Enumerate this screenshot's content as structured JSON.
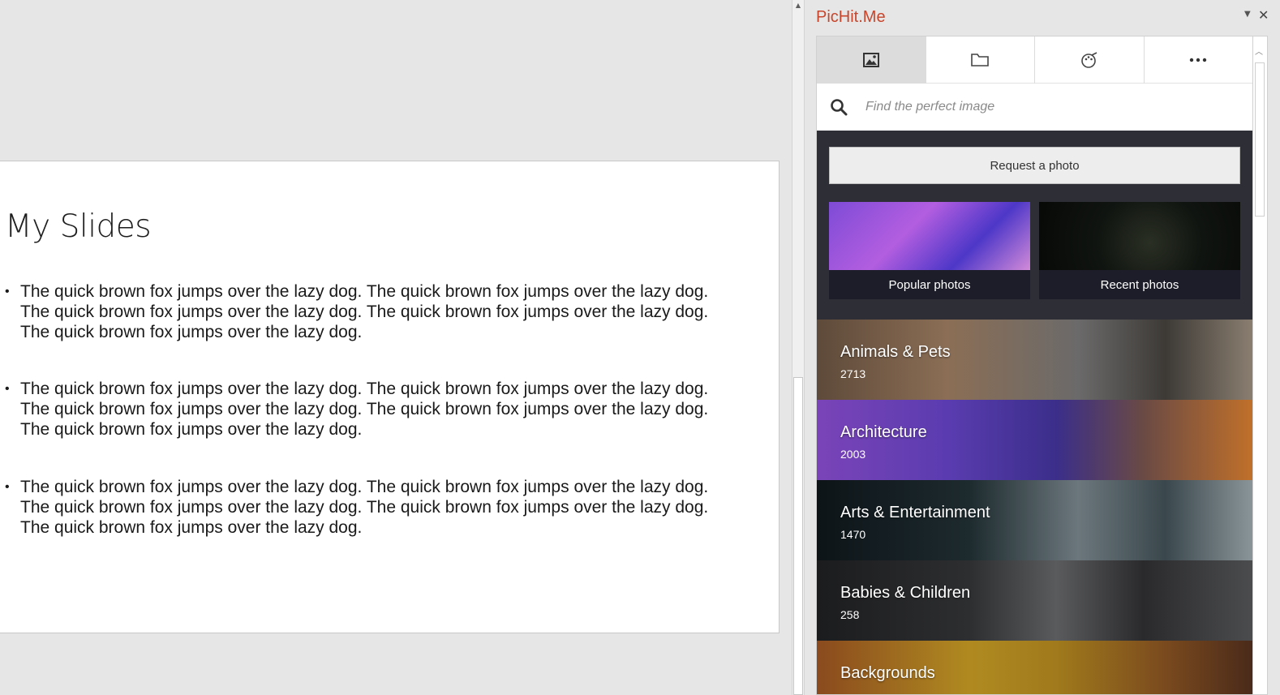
{
  "slide": {
    "title": "My Slides",
    "bullets": [
      "The quick brown fox jumps over the lazy dog. The quick brown fox jumps over the lazy dog. The quick brown fox jumps over the lazy dog. The quick brown fox jumps over the lazy dog. The quick brown fox jumps over the lazy dog.",
      "The quick brown fox jumps over the lazy dog. The quick brown fox jumps over the lazy dog. The quick brown fox jumps over the lazy dog. The quick brown fox jumps over the lazy dog. The quick brown fox jumps over the lazy dog.",
      "The quick brown fox jumps over the lazy dog. The quick brown fox jumps over the lazy dog. The quick brown fox jumps over the lazy dog. The quick brown fox jumps over the lazy dog. The quick brown fox jumps over the lazy dog."
    ]
  },
  "pane": {
    "title": "PicHit.Me",
    "tabs": [
      {
        "icon": "image-icon",
        "active": true
      },
      {
        "icon": "folder-icon",
        "active": false
      },
      {
        "icon": "palette-icon",
        "active": false
      },
      {
        "icon": "more-icon",
        "active": false
      }
    ],
    "search_placeholder": "Find the perfect image",
    "request_label": "Request a photo",
    "featured": [
      {
        "label": "Popular photos"
      },
      {
        "label": "Recent photos"
      }
    ],
    "categories": [
      {
        "name": "Animals & Pets",
        "count": "2713"
      },
      {
        "name": "Architecture",
        "count": "2003"
      },
      {
        "name": "Arts & Entertainment",
        "count": "1470"
      },
      {
        "name": "Babies & Children",
        "count": "258"
      },
      {
        "name": "Backgrounds",
        "count": ""
      }
    ]
  },
  "colors": {
    "accent": "#c8452b",
    "dark_panel": "#2d2e36"
  }
}
